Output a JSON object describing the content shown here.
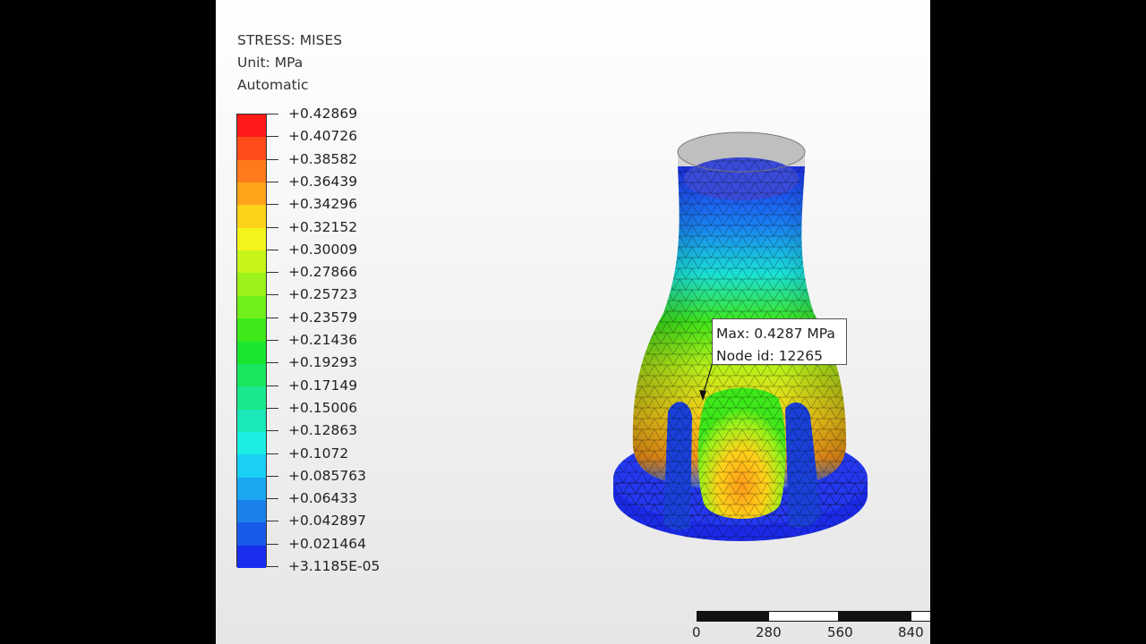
{
  "legend": {
    "title": "STRESS: MISES",
    "unit": "Unit: MPa",
    "mode": "Automatic",
    "ticks": [
      "+0.42869",
      "+0.40726",
      "+0.38582",
      "+0.36439",
      "+0.34296",
      "+0.32152",
      "+0.30009",
      "+0.27866",
      "+0.25723",
      "+0.23579",
      "+0.21436",
      "+0.19293",
      "+0.17149",
      "+0.15006",
      "+0.12863",
      "+0.1072",
      "+0.085763",
      "+0.06433",
      "+0.042897",
      "+0.021464",
      "+3.1185E-05"
    ],
    "colors": [
      "#ff1a1a",
      "#ff4d1a",
      "#ff7a1a",
      "#ffa31a",
      "#ffd21a",
      "#f4f41a",
      "#c8f41a",
      "#9cf21a",
      "#6ff01a",
      "#3ee81a",
      "#1ae62e",
      "#1ae65f",
      "#1ae88d",
      "#1ae8b8",
      "#1aeee2",
      "#1acef4",
      "#1aa8f0",
      "#1a80ea",
      "#1a5aea",
      "#1a2ef0"
    ]
  },
  "callout": {
    "max": "Max: 0.4287 MPa",
    "node": "Node id: 12265"
  },
  "scalebar": {
    "labels": [
      "0",
      "280",
      "560",
      "840"
    ]
  }
}
